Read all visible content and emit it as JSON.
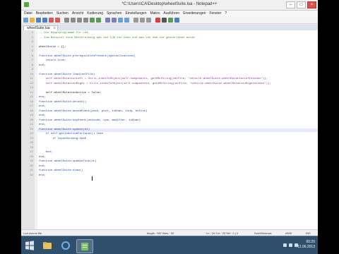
{
  "window": {
    "title": "*C:\\Users\\CA\\Desktop\\wheelSuite.lua - Notepad++"
  },
  "menu": [
    "Datei",
    "Bearbeiten",
    "Suchen",
    "Ansicht",
    "Kodierung",
    "Sprachen",
    "Einstellungen",
    "Makro",
    "Ausführen",
    "Erweiterungen",
    "Fenster",
    "?"
  ],
  "toolbar_icons": [
    "new-file-icon",
    "open-file-icon",
    "save-icon",
    "save-all-icon",
    "close-icon",
    "close-all-icon",
    "print-icon",
    "cut-icon",
    "copy-icon",
    "paste-icon",
    "undo-icon",
    "redo-icon",
    "find-icon",
    "replace-icon",
    "zoom-in-icon",
    "zoom-out-icon",
    "sync-icon",
    "wrap-icon",
    "indent-guide-icon",
    "macro-record-icon",
    "macro-stop-icon",
    "macro-play-icon",
    "macro-save-icon"
  ],
  "toolbar_colors": [
    "#6aa0d8",
    "#e1b44c",
    "#4d7fc4",
    "#4d7fc4",
    "#d25c5c",
    "#d25c5c",
    "#8a8a8a",
    "#8a8a8a",
    "#8a8a8a",
    "#8a8a8a",
    "#5c9a5c",
    "#5c9a5c",
    "#7f7fb8",
    "#7f7fb8",
    "#6aa0d8",
    "#6aa0d8",
    "#9a9a9a",
    "#9a9a9a",
    "#9a9a9a",
    "#c44",
    "#555",
    "#5c9a5c",
    "#4d7fc4"
  ],
  "tab": {
    "label": "wheelSuite.lua",
    "close_glyph": "x"
  },
  "editor": {
    "lines": [
      {
        "num": "1",
        "text": "-- Die Hauptprogramme für LUA",
        "style": "comment"
      },
      {
        "num": "2",
        "text": "-- Zum Beispiel eine Beschreibung was die LUA tun kann und was von dem die geschrieben wurde",
        "style": "comment"
      },
      {
        "num": "3",
        "text": "",
        "style": ""
      },
      {
        "num": "4",
        "text": "wheelSuite = {};",
        "style": ""
      },
      {
        "num": "5",
        "text": "",
        "style": ""
      },
      {
        "num": "6",
        "text": "function wheelSuite.prerequisitesPresent(specializations)",
        "style": "kw"
      },
      {
        "num": "7",
        "text": "    return true;",
        "style": "kw"
      },
      {
        "num": "8",
        "text": "end;",
        "style": "kw"
      },
      {
        "num": "9",
        "text": "",
        "style": ""
      },
      {
        "num": "10",
        "text": "function wheelSuite:load(xmlFile)",
        "style": "kw"
      },
      {
        "num": "11",
        "text": "    self.wheelRotationLeft = Utils.indexToObject(self.components, getXMLString(xmlFile, \"vehicle.wheelSuite.wheelRotationLeft#index\"));",
        "style": "str"
      },
      {
        "num": "12",
        "text": "    self.wheelRotationRight = Utils.indexToObject(self.components, getXMLString(xmlFile, \"vehicle.wheelSuite.wheelRotationRight#index\"));",
        "style": "str"
      },
      {
        "num": "13",
        "text": "",
        "style": ""
      },
      {
        "num": "14",
        "text": "    self.wheelRotationActive = false;",
        "style": ""
      },
      {
        "num": "15",
        "text": "end;",
        "style": "kw"
      },
      {
        "num": "16",
        "text": "function wheelSuite:delete()",
        "style": "kw"
      },
      {
        "num": "17",
        "text": "end;",
        "style": "kw"
      },
      {
        "num": "18",
        "text": "function wheelSuite:mouseEvent(posX, posY, isDown, isUp, button)",
        "style": "kw"
      },
      {
        "num": "19",
        "text": "end;",
        "style": "kw"
      },
      {
        "num": "20",
        "text": "function wheelSuite:keyEvent(unicode, sym, modifier, isDown)",
        "style": "kw"
      },
      {
        "num": "21",
        "text": "end;",
        "style": "kw"
      },
      {
        "num": "22",
        "text": "function wheelSuite:update(dt)",
        "style": "kw"
      },
      {
        "num": "23",
        "text": "    if self:getIsActiveForInput() then",
        "style": "kw"
      },
      {
        "num": "24",
        "text": "        if InputBinding.hasE",
        "style": "kw"
      },
      {
        "num": "25",
        "text": "",
        "style": ""
      },
      {
        "num": "26",
        "text": "",
        "style": ""
      },
      {
        "num": "27",
        "text": "    end;",
        "style": "kw"
      },
      {
        "num": "28",
        "text": "end;",
        "style": "kw"
      },
      {
        "num": "29",
        "text": "function wheelSuite:updateTick(dt)",
        "style": "kw"
      },
      {
        "num": "30",
        "text": "end;",
        "style": "kw"
      },
      {
        "num": "31",
        "text": "function wheelSuite:draw()",
        "style": "kw"
      },
      {
        "num": "32",
        "text": "end;",
        "style": "kw"
      }
    ]
  },
  "status": {
    "type": "Lua source file",
    "length": "length : 987   lines : 33",
    "position": "Ln : 24   Col : 33   Sel : 0 | 0",
    "eol": "Dos\\Windows",
    "encoding": "ANSI",
    "mode": "INS"
  },
  "tray": {
    "time": "00:20",
    "date": "11.06.2013"
  }
}
